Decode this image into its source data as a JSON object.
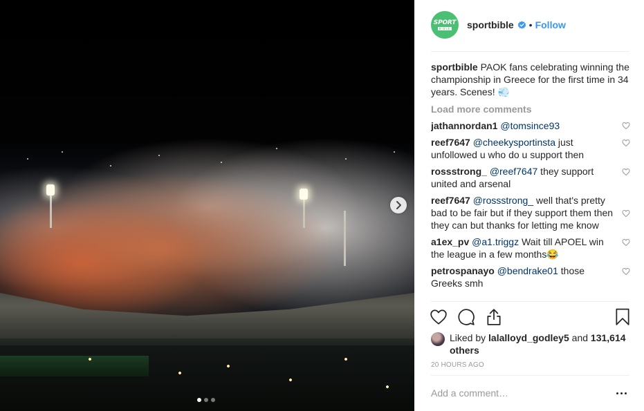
{
  "post": {
    "next_label": "Next",
    "carousel": {
      "total": 3,
      "active": 1
    }
  },
  "header": {
    "avatar_text_line1": "SPORT",
    "avatar_text_line2": "BIBLE",
    "username": "sportbible",
    "separator": "•",
    "follow_label": "Follow"
  },
  "caption": {
    "username": "sportbible",
    "text": "PAOK fans celebrating winning the championship in Greece for the first time in 34 years. Scenes! 💨"
  },
  "load_more_label": "Load more comments",
  "comments": [
    {
      "username": "jathannordan1",
      "mention": "@tomsince93",
      "text": ""
    },
    {
      "username": "reef7647",
      "mention": "@cheekysportinsta",
      "text": " just unfollowed u who do u support then"
    },
    {
      "username": "rossstrong_",
      "mention": "@reef7647",
      "text": " they support united and arsenal"
    },
    {
      "username": "reef7647",
      "mention": "@rossstrong_",
      "text": " well that's pretty bad to be fair but if they support them then they can but thanks for letting me know"
    },
    {
      "username": "a1ex_pv",
      "mention": "@a1.triggz",
      "text": " Wait till APOEL win the league in a few months😂"
    },
    {
      "username": "petrospanayo",
      "mention": "@bendrake01",
      "text": " those Greeks smh"
    }
  ],
  "likes": {
    "prefix": "Liked by ",
    "user": "lalalloyd_godley5",
    "middle": " and ",
    "count": "131,614 others"
  },
  "timestamp": "20 HOURS AGO",
  "add_comment_placeholder": "Add a comment…",
  "colors": {
    "accent": "#3897f0",
    "brand_green": "#4bbf73",
    "muted": "#999999"
  }
}
